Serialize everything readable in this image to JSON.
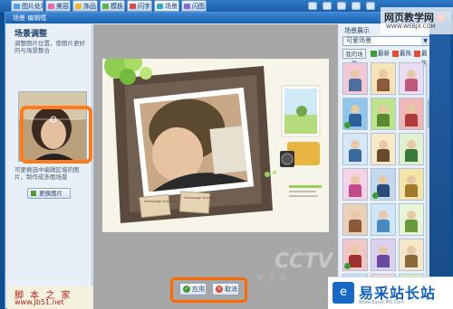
{
  "toolbar": {
    "tabs": [
      {
        "label": "图片处理",
        "color": "#5a9ee3"
      },
      {
        "label": "美容",
        "color": "#e46ca8"
      },
      {
        "label": "饰品",
        "color": "#f2b53a"
      },
      {
        "label": "模板",
        "color": "#5db34a"
      },
      {
        "label": "闪字",
        "color": "#cf4d4d"
      },
      {
        "label": "场景",
        "color": "#37a7c8"
      },
      {
        "label": "闪图",
        "color": "#8a6ad2"
      }
    ],
    "tools": [
      "open-icon",
      "save-icon",
      "print-icon",
      "undo-icon",
      "redo-icon",
      "new-icon",
      "help-icon"
    ]
  },
  "window": {
    "title": "场景 编辑框",
    "close": "×"
  },
  "left_panel": {
    "heading": "场景调整",
    "description": "调整图片位置，使图片更好的与场景整合",
    "tip": "可更换选中编辑区域的图片，制作成多图场景",
    "replace_button": "更换图片"
  },
  "canvas": {
    "note1": "Homepage Shortcut",
    "note2": "Homepage Shortcut",
    "watermark": "CCTV",
    "watermark_sub": "专 业 的",
    "apply_button": "应用",
    "cancel_button": "取消"
  },
  "right_panel": {
    "heading": "场景展示",
    "selected_scene": "可爱场景",
    "tabs": [
      "我的场景",
      "最新",
      "最热",
      "最热"
    ]
  },
  "site_watermark": {
    "title": "网页教学网",
    "url": "WWW.WEBJX.COM"
  },
  "left_watermark": {
    "title": "脚 本 之 家",
    "url": "www.Jb51.net"
  },
  "logo": {
    "mark": "e",
    "name": "易采站长站",
    "url": "Www.EasyCMS.Com"
  }
}
